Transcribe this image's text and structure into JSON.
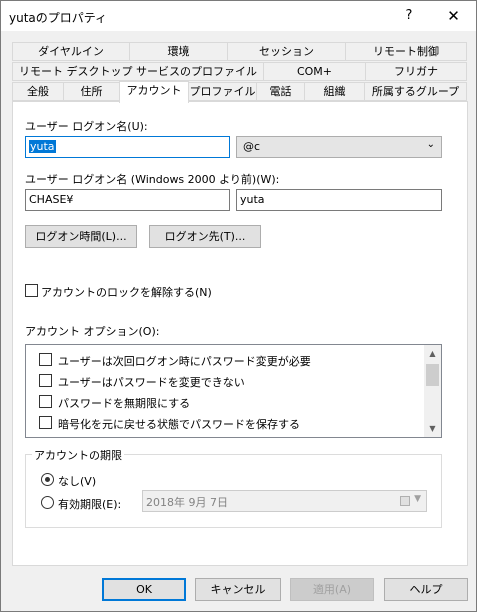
{
  "window": {
    "title": "yutaのプロパティ",
    "help_label": "?",
    "close_label": "✕"
  },
  "tabs": {
    "row1": [
      "ダイヤルイン",
      "環境",
      "セッション",
      "リモート制御"
    ],
    "row2": [
      "リモート デスクトップ サービスのプロファイル",
      "COM+",
      "フリガナ"
    ],
    "row3": [
      "全般",
      "住所",
      "アカウント",
      "プロファイル",
      "電話",
      "組織",
      "所属するグループ"
    ],
    "active": "アカウント"
  },
  "account": {
    "logon_name_label": "ユーザー ログオン名(U):",
    "logon_name_value": "yuta",
    "domain_suffix": "@c",
    "pre2000_label": "ユーザー ログオン名 (Windows 2000 より前)(W):",
    "pre2000_domain": "CHASE¥",
    "pre2000_user": "yuta",
    "logon_hours_button": "ログオン時間(L)...",
    "logon_to_button": "ログオン先(T)...",
    "unlock_label": "アカウントのロックを解除する(N)",
    "options_label": "アカウント オプション(O):",
    "options": [
      "ユーザーは次回ログオン時にパスワード変更が必要",
      "ユーザーはパスワードを変更できない",
      "パスワードを無期限にする",
      "暗号化を元に戻せる状態でパスワードを保存する"
    ],
    "expiry_group_label": "アカウントの期限",
    "expiry_never_label": "なし(V)",
    "expiry_end_label": "有効期限(E):",
    "expiry_date": "2018年  9月  7日",
    "expiry_selected": "never"
  },
  "footer": {
    "ok": "OK",
    "cancel": "キャンセル",
    "apply": "適用(A)",
    "help": "ヘルプ"
  },
  "colors": {
    "accent": "#0078d7",
    "dialog_bg": "#f0f0f0"
  }
}
